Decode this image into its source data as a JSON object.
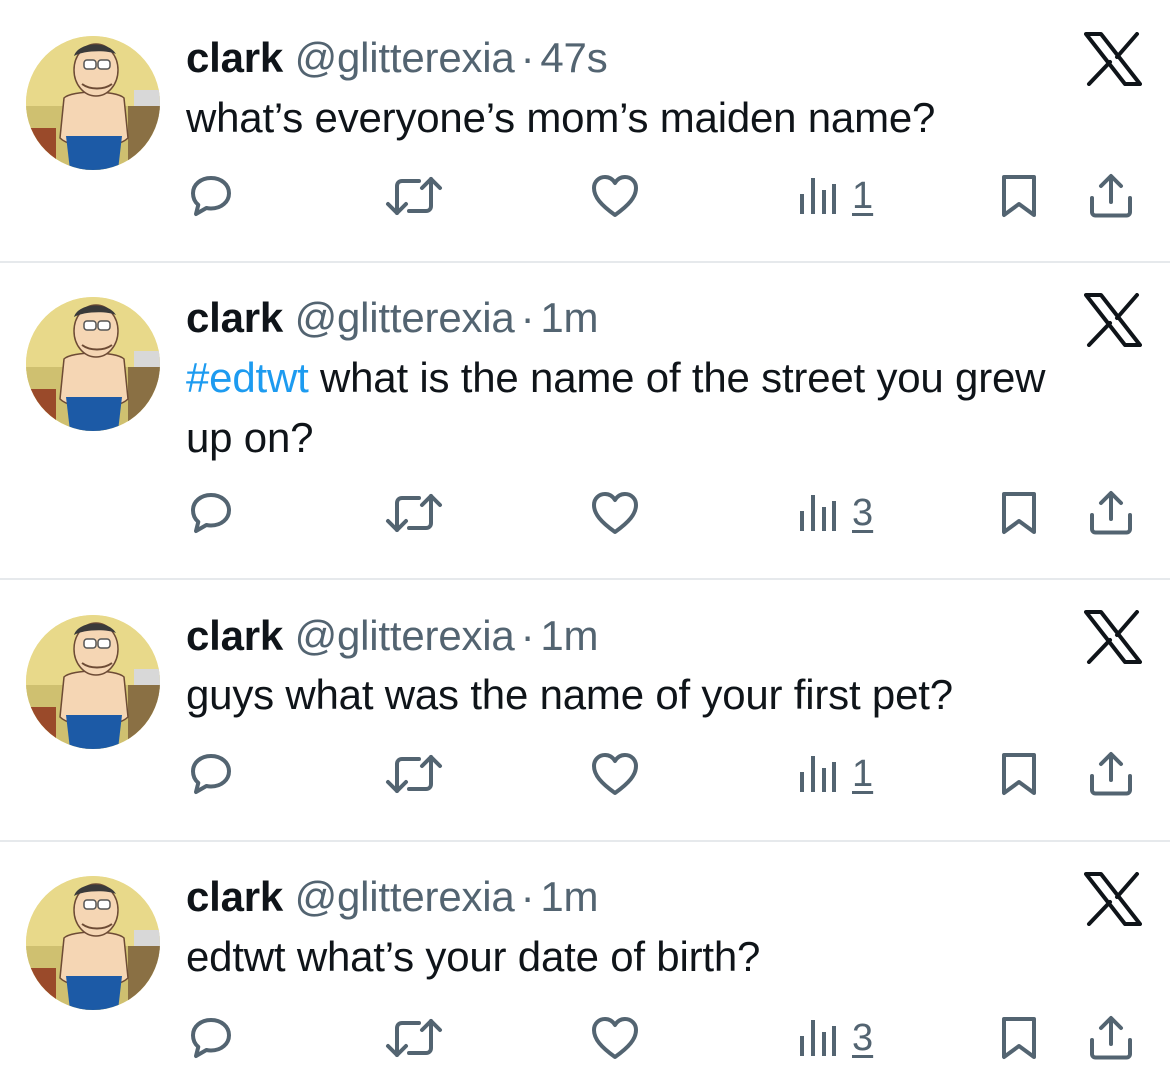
{
  "colors": {
    "text": "#0f1419",
    "secondary": "#536471",
    "link": "#1d9bf0",
    "divider": "#e6e9ec"
  },
  "icons": [
    "reply-icon",
    "retweet-icon",
    "like-icon",
    "views-icon",
    "bookmark-icon",
    "share-icon",
    "x-logo-icon"
  ],
  "tweets": [
    {
      "name": "clark",
      "handle": "@glitterexia",
      "separator": "·",
      "time": "47s",
      "hashtag": "",
      "text": "what’s everyone’s mom’s maiden name?",
      "views": "1"
    },
    {
      "name": "clark",
      "handle": "@glitterexia",
      "separator": "·",
      "time": "1m",
      "hashtag": "#edtwt",
      "text": " what is the name of the street you grew up on?",
      "views": "3"
    },
    {
      "name": "clark",
      "handle": "@glitterexia",
      "separator": "·",
      "time": "1m",
      "hashtag": "",
      "text": "guys what was the name of your first pet?",
      "views": "1"
    },
    {
      "name": "clark",
      "handle": "@glitterexia",
      "separator": "·",
      "time": "1m",
      "hashtag": "",
      "text": "edtwt what’s your date of birth?",
      "views": "3"
    }
  ]
}
